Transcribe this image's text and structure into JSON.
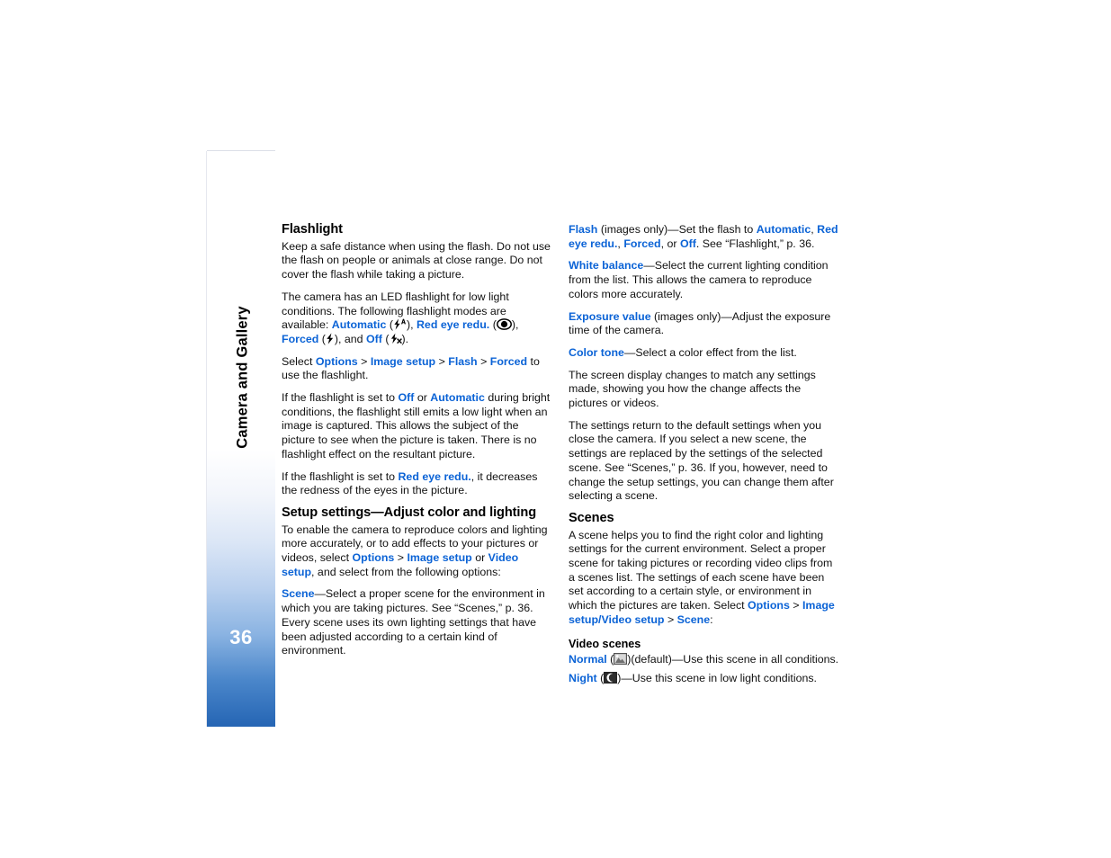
{
  "sidebar": {
    "chapter_title": "Camera and Gallery",
    "page_number": "36",
    "accent_color": "#2565b4"
  },
  "theme": {
    "link_color": "#0b63d6",
    "text_color": "#111111",
    "page_background": "#ffffff"
  },
  "left_column": {
    "heading": "Flashlight",
    "p1": "Keep a safe distance when using the flash. Do not use the flash on people or animals at close range. Do not cover the flash while taking a picture.",
    "p2_a": "The camera has an LED flashlight for low light conditions. The following flashlight modes are available: ",
    "p2_automatic": "Automatic",
    "p2_b": " (",
    "p2_c": "), ",
    "p2_redeye": "Red eye redu.",
    "p2_d": " (",
    "p2_e": "), ",
    "p2_forced": "Forced",
    "p2_f": " (",
    "p2_g": "), and ",
    "p2_off": "Off",
    "p2_h": " (",
    "p2_i": ").",
    "p3_a": "Select ",
    "p3_options": "Options",
    "p3_sep1": " > ",
    "p3_imagesetup": "Image setup",
    "p3_sep2": " > ",
    "p3_flash": "Flash",
    "p3_sep3": " > ",
    "p3_forced": "Forced",
    "p3_b": " to use the flashlight.",
    "p4_a": "If the flashlight is set to ",
    "p4_off": "Off",
    "p4_b": " or ",
    "p4_automatic": "Automatic",
    "p4_c": " during bright conditions, the flashlight still emits a low light when an image is captured. This allows the subject of the picture to see when the picture is taken. There is no flashlight effect on the resultant picture.",
    "p5_a": "If the flashlight is set to ",
    "p5_redeye": "Red eye redu.",
    "p5_b": ", it decreases the redness of the eyes in the picture.",
    "heading2": "Setup settings—Adjust color and lighting",
    "p6_a": "To enable the camera to reproduce colors and lighting more accurately, or to add effects to your pictures or videos, select ",
    "p6_options": "Options",
    "p6_sep1": " > ",
    "p6_imagesetup": "Image setup",
    "p6_b": " or ",
    "p6_videosetup": "Video setup",
    "p6_c": ", and select from the following options:",
    "p7_scene": "Scene",
    "p7_a": "—Select a proper scene for the environment in which you are taking pictures. See “Scenes,” p. 36. Every scene uses its own lighting settings that have been adjusted according to a certain kind of environment."
  },
  "right_column": {
    "p1_flash": "Flash",
    "p1_a": " (images only)—Set the flash to ",
    "p1_automatic": "Automatic",
    "p1_b": ", ",
    "p1_redeye": "Red eye redu.",
    "p1_c": ", ",
    "p1_forced": "Forced",
    "p1_d": ", or ",
    "p1_off": "Off",
    "p1_e": ". See “Flashlight,” p. 36.",
    "p2_whitebalance": "White balance",
    "p2_a": "—Select the current lighting condition from the list. This allows the camera to reproduce colors more accurately.",
    "p3_exposure": "Exposure value",
    "p3_a": " (images only)—Adjust the exposure time of the camera.",
    "p4_colortone": "Color tone",
    "p4_a": "—Select a color effect from the list.",
    "p5": "The screen display changes to match any settings made, showing you how the change affects the pictures or videos.",
    "p6": "The settings return to the default settings when you close the camera. If you select a new scene, the settings are replaced by the settings of the selected scene. See “Scenes,” p. 36. If you, however, need to change the setup settings, you can change them after selecting a scene.",
    "heading_scenes": "Scenes",
    "p7_a": "A scene helps you to find the right color and lighting settings for the current environment. Select a proper scene for taking pictures or recording video clips from a scenes list. The settings of each scene have been set according to a certain style, or environment in which the pictures are taken. Select ",
    "p7_options": "Options",
    "p7_sep1": " > ",
    "p7_imagesetup": "Image setup",
    "p7_slash": "/",
    "p7_videosetup": "Video setup",
    "p7_sep2": " > ",
    "p7_scene": "Scene",
    "p7_colon": ":",
    "subhead_video_scenes": "Video scenes",
    "normal_label": "Normal",
    "normal_open": " (",
    "normal_close": ")(default)—Use this scene in all conditions.",
    "night_label": "Night",
    "night_open": " (",
    "night_close": ")—Use this scene in low light conditions."
  },
  "icons": {
    "flash_automatic": "flash-automatic-icon",
    "flash_redeye": "red-eye-reduction-icon",
    "flash_forced": "flash-forced-icon",
    "flash_off": "flash-off-icon",
    "scene_normal": "scene-normal-icon",
    "scene_night": "scene-night-moon-icon"
  }
}
